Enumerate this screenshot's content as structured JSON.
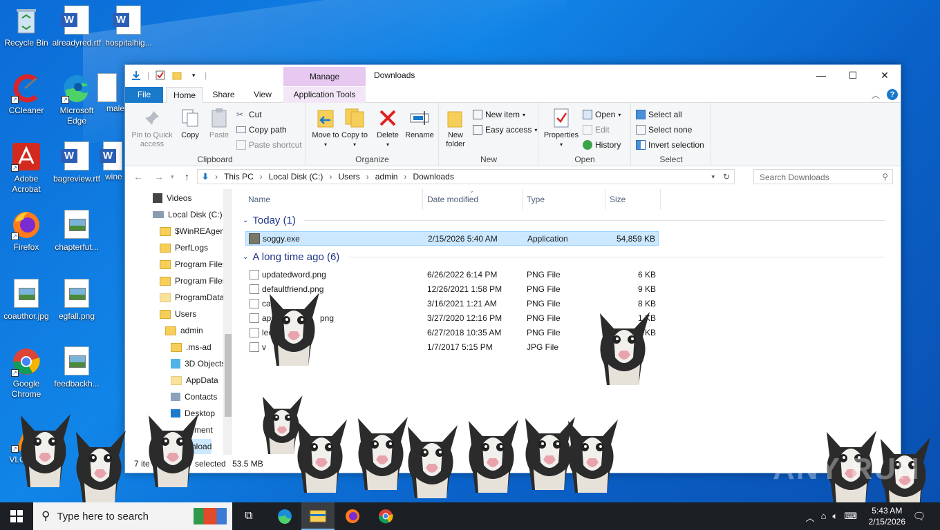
{
  "desktop": {
    "icons": [
      {
        "label": "Recycle Bin"
      },
      {
        "label": "alreadyred.rtf"
      },
      {
        "label": "hospitalhig..."
      },
      {
        "label": "CCleaner"
      },
      {
        "label": "Microsoft Edge"
      },
      {
        "label": "male"
      },
      {
        "label": "Adobe Acrobat"
      },
      {
        "label": "bagreview.rtf"
      },
      {
        "label": "wine"
      },
      {
        "label": "Firefox"
      },
      {
        "label": "chapterfut..."
      },
      {
        "label": "coauthor.jpg"
      },
      {
        "label": "egfall.png"
      },
      {
        "label": "Google Chrome"
      },
      {
        "label": "feedbackh..."
      },
      {
        "label": "VLC m pl"
      }
    ]
  },
  "window": {
    "title": "Downloads",
    "contextual_tab_header": "Manage",
    "controls": {
      "minimize": "—",
      "maximize": "☐",
      "close": "✕"
    }
  },
  "ribbon": {
    "tabs": [
      "File",
      "Home",
      "Share",
      "View",
      "Application Tools"
    ],
    "active_tab": "Home",
    "clipboard": {
      "pin": "Pin to Quick access",
      "copy": "Copy",
      "paste": "Paste",
      "cut": "Cut",
      "copy_path": "Copy path",
      "paste_shortcut": "Paste shortcut",
      "title": "Clipboard"
    },
    "organize": {
      "move_to": "Move to",
      "copy_to": "Copy to",
      "delete": "Delete",
      "rename": "Rename",
      "title": "Organize"
    },
    "new": {
      "new_folder": "New folder",
      "new_item": "New item",
      "easy_access": "Easy access",
      "title": "New"
    },
    "open": {
      "properties": "Properties",
      "open": "Open",
      "edit": "Edit",
      "history": "History",
      "title": "Open"
    },
    "select": {
      "select_all": "Select all",
      "select_none": "Select none",
      "invert": "Invert selection",
      "title": "Select"
    }
  },
  "address": {
    "crumbs": [
      "This PC",
      "Local Disk (C:)",
      "Users",
      "admin",
      "Downloads"
    ],
    "search_placeholder": "Search Downloads"
  },
  "navpane": {
    "items": [
      {
        "label": "Videos"
      },
      {
        "label": "Local Disk (C:)"
      },
      {
        "label": "$WinREAgent"
      },
      {
        "label": "PerfLogs"
      },
      {
        "label": "Program Files"
      },
      {
        "label": "Program Files"
      },
      {
        "label": "ProgramData"
      },
      {
        "label": "Users"
      },
      {
        "label": "admin"
      },
      {
        "label": ".ms-ad"
      },
      {
        "label": "3D Objects"
      },
      {
        "label": "AppData"
      },
      {
        "label": "Contacts"
      },
      {
        "label": "Desktop"
      },
      {
        "label": "ment"
      },
      {
        "label": "nload"
      }
    ]
  },
  "files": {
    "columns": [
      "Name",
      "Date modified",
      "Type",
      "Size"
    ],
    "groups": [
      {
        "label": "Today (1)",
        "rows": [
          {
            "name": "soggy.exe",
            "date": "2/15/2026 5:40 AM",
            "type": "Application",
            "size": "54,859 KB"
          }
        ]
      },
      {
        "label": "A long time ago (6)",
        "rows": [
          {
            "name": "updatedword.png",
            "date": "6/26/2022 6:14 PM",
            "type": "PNG File",
            "size": "6 KB"
          },
          {
            "name": "defaultfriend.png",
            "date": "12/26/2021 1:58 PM",
            "type": "PNG File",
            "size": "9 KB"
          },
          {
            "name": "ca",
            "date": "3/16/2021 1:21 AM",
            "type": "PNG File",
            "size": "8 KB"
          },
          {
            "name": "app",
            "extra": "png",
            "date": "3/27/2020 12:16 PM",
            "type": "PNG File",
            "size": "1 KB"
          },
          {
            "name": "lee",
            "date": "6/27/2018 10:35 AM",
            "type": "PNG File",
            "size": "1 KB"
          },
          {
            "name": "v",
            "date": "1/7/2017 5:15 PM",
            "type": "JPG File",
            "size": ""
          }
        ]
      }
    ]
  },
  "status": {
    "items": "7 ite",
    "selected": "selected",
    "size": "53.5 MB"
  },
  "taskbar": {
    "search_placeholder": "Type here to search",
    "time": "5:43 AM",
    "date": "2/15/2026"
  },
  "watermark": "ANY RUN"
}
